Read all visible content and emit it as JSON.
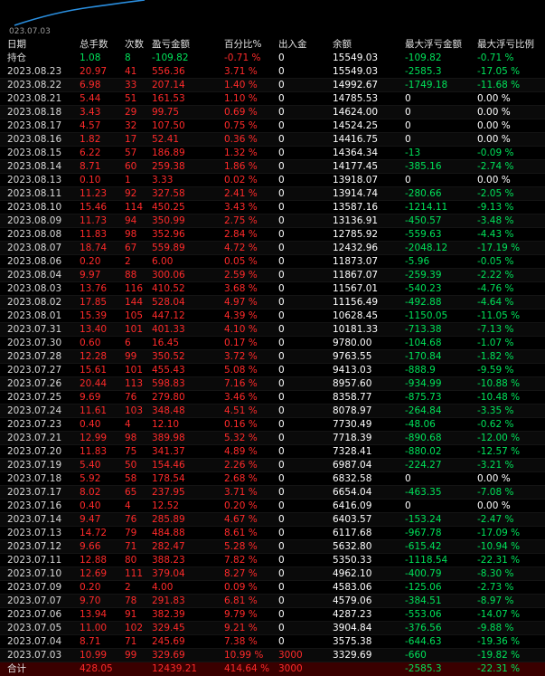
{
  "chart": {
    "date_label": "023.07.03"
  },
  "headers": [
    "日期",
    "总手数",
    "次数",
    "盈亏金额",
    "百分比%",
    "出入金",
    "余额",
    "最大浮亏金额",
    "最大浮亏比例"
  ],
  "position_row": {
    "date": "持仓",
    "lots": "1.08",
    "count": "8",
    "pnl": "-109.82",
    "pct": "-0.71 %",
    "flow": "0",
    "balance": "15549.03",
    "maxloss": "-109.82",
    "maxloss_pct": "-0.71 %"
  },
  "rows": [
    {
      "date": "2023.08.23",
      "lots": "20.97",
      "count": "41",
      "pnl": "556.36",
      "pct": "3.71 %",
      "flow": "0",
      "balance": "15549.03",
      "maxloss": "-2585.3",
      "maxloss_pct": "-17.05 %"
    },
    {
      "date": "2023.08.22",
      "lots": "6.98",
      "count": "33",
      "pnl": "207.14",
      "pct": "1.40 %",
      "flow": "0",
      "balance": "14992.67",
      "maxloss": "-1749.18",
      "maxloss_pct": "-11.68 %"
    },
    {
      "date": "2023.08.21",
      "lots": "5.44",
      "count": "51",
      "pnl": "161.53",
      "pct": "1.10 %",
      "flow": "0",
      "balance": "14785.53",
      "maxloss": "0",
      "maxloss_pct": "0.00 %"
    },
    {
      "date": "2023.08.18",
      "lots": "3.43",
      "count": "29",
      "pnl": "99.75",
      "pct": "0.69 %",
      "flow": "0",
      "balance": "14624.00",
      "maxloss": "0",
      "maxloss_pct": "0.00 %"
    },
    {
      "date": "2023.08.17",
      "lots": "4.57",
      "count": "32",
      "pnl": "107.50",
      "pct": "0.75 %",
      "flow": "0",
      "balance": "14524.25",
      "maxloss": "0",
      "maxloss_pct": "0.00 %"
    },
    {
      "date": "2023.08.16",
      "lots": "1.82",
      "count": "17",
      "pnl": "52.41",
      "pct": "0.36 %",
      "flow": "0",
      "balance": "14416.75",
      "maxloss": "0",
      "maxloss_pct": "0.00 %"
    },
    {
      "date": "2023.08.15",
      "lots": "6.22",
      "count": "57",
      "pnl": "186.89",
      "pct": "1.32 %",
      "flow": "0",
      "balance": "14364.34",
      "maxloss": "-13",
      "maxloss_pct": "-0.09 %"
    },
    {
      "date": "2023.08.14",
      "lots": "8.71",
      "count": "60",
      "pnl": "259.38",
      "pct": "1.86 %",
      "flow": "0",
      "balance": "14177.45",
      "maxloss": "-385.16",
      "maxloss_pct": "-2.74 %"
    },
    {
      "date": "2023.08.13",
      "lots": "0.10",
      "count": "1",
      "pnl": "3.33",
      "pct": "0.02 %",
      "flow": "0",
      "balance": "13918.07",
      "maxloss": "0",
      "maxloss_pct": "0.00 %"
    },
    {
      "date": "2023.08.11",
      "lots": "11.23",
      "count": "92",
      "pnl": "327.58",
      "pct": "2.41 %",
      "flow": "0",
      "balance": "13914.74",
      "maxloss": "-280.66",
      "maxloss_pct": "-2.05 %"
    },
    {
      "date": "2023.08.10",
      "lots": "15.46",
      "count": "114",
      "pnl": "450.25",
      "pct": "3.43 %",
      "flow": "0",
      "balance": "13587.16",
      "maxloss": "-1214.11",
      "maxloss_pct": "-9.13 %"
    },
    {
      "date": "2023.08.09",
      "lots": "11.73",
      "count": "94",
      "pnl": "350.99",
      "pct": "2.75 %",
      "flow": "0",
      "balance": "13136.91",
      "maxloss": "-450.57",
      "maxloss_pct": "-3.48 %"
    },
    {
      "date": "2023.08.08",
      "lots": "11.83",
      "count": "98",
      "pnl": "352.96",
      "pct": "2.84 %",
      "flow": "0",
      "balance": "12785.92",
      "maxloss": "-559.63",
      "maxloss_pct": "-4.43 %"
    },
    {
      "date": "2023.08.07",
      "lots": "18.74",
      "count": "67",
      "pnl": "559.89",
      "pct": "4.72 %",
      "flow": "0",
      "balance": "12432.96",
      "maxloss": "-2048.12",
      "maxloss_pct": "-17.19 %"
    },
    {
      "date": "2023.08.06",
      "lots": "0.20",
      "count": "2",
      "pnl": "6.00",
      "pct": "0.05 %",
      "flow": "0",
      "balance": "11873.07",
      "maxloss": "-5.96",
      "maxloss_pct": "-0.05 %"
    },
    {
      "date": "2023.08.04",
      "lots": "9.97",
      "count": "88",
      "pnl": "300.06",
      "pct": "2.59 %",
      "flow": "0",
      "balance": "11867.07",
      "maxloss": "-259.39",
      "maxloss_pct": "-2.22 %"
    },
    {
      "date": "2023.08.03",
      "lots": "13.76",
      "count": "116",
      "pnl": "410.52",
      "pct": "3.68 %",
      "flow": "0",
      "balance": "11567.01",
      "maxloss": "-540.23",
      "maxloss_pct": "-4.76 %"
    },
    {
      "date": "2023.08.02",
      "lots": "17.85",
      "count": "144",
      "pnl": "528.04",
      "pct": "4.97 %",
      "flow": "0",
      "balance": "11156.49",
      "maxloss": "-492.88",
      "maxloss_pct": "-4.64 %"
    },
    {
      "date": "2023.08.01",
      "lots": "15.39",
      "count": "105",
      "pnl": "447.12",
      "pct": "4.39 %",
      "flow": "0",
      "balance": "10628.45",
      "maxloss": "-1150.05",
      "maxloss_pct": "-11.05 %"
    },
    {
      "date": "2023.07.31",
      "lots": "13.40",
      "count": "101",
      "pnl": "401.33",
      "pct": "4.10 %",
      "flow": "0",
      "balance": "10181.33",
      "maxloss": "-713.38",
      "maxloss_pct": "-7.13 %"
    },
    {
      "date": "2023.07.30",
      "lots": "0.60",
      "count": "6",
      "pnl": "16.45",
      "pct": "0.17 %",
      "flow": "0",
      "balance": "9780.00",
      "maxloss": "-104.68",
      "maxloss_pct": "-1.07 %"
    },
    {
      "date": "2023.07.28",
      "lots": "12.28",
      "count": "99",
      "pnl": "350.52",
      "pct": "3.72 %",
      "flow": "0",
      "balance": "9763.55",
      "maxloss": "-170.84",
      "maxloss_pct": "-1.82 %"
    },
    {
      "date": "2023.07.27",
      "lots": "15.61",
      "count": "101",
      "pnl": "455.43",
      "pct": "5.08 %",
      "flow": "0",
      "balance": "9413.03",
      "maxloss": "-888.9",
      "maxloss_pct": "-9.59 %"
    },
    {
      "date": "2023.07.26",
      "lots": "20.44",
      "count": "113",
      "pnl": "598.83",
      "pct": "7.16 %",
      "flow": "0",
      "balance": "8957.60",
      "maxloss": "-934.99",
      "maxloss_pct": "-10.88 %"
    },
    {
      "date": "2023.07.25",
      "lots": "9.69",
      "count": "76",
      "pnl": "279.80",
      "pct": "3.46 %",
      "flow": "0",
      "balance": "8358.77",
      "maxloss": "-875.73",
      "maxloss_pct": "-10.48 %"
    },
    {
      "date": "2023.07.24",
      "lots": "11.61",
      "count": "103",
      "pnl": "348.48",
      "pct": "4.51 %",
      "flow": "0",
      "balance": "8078.97",
      "maxloss": "-264.84",
      "maxloss_pct": "-3.35 %"
    },
    {
      "date": "2023.07.23",
      "lots": "0.40",
      "count": "4",
      "pnl": "12.10",
      "pct": "0.16 %",
      "flow": "0",
      "balance": "7730.49",
      "maxloss": "-48.06",
      "maxloss_pct": "-0.62 %"
    },
    {
      "date": "2023.07.21",
      "lots": "12.99",
      "count": "98",
      "pnl": "389.98",
      "pct": "5.32 %",
      "flow": "0",
      "balance": "7718.39",
      "maxloss": "-890.68",
      "maxloss_pct": "-12.00 %"
    },
    {
      "date": "2023.07.20",
      "lots": "11.83",
      "count": "75",
      "pnl": "341.37",
      "pct": "4.89 %",
      "flow": "0",
      "balance": "7328.41",
      "maxloss": "-880.02",
      "maxloss_pct": "-12.57 %"
    },
    {
      "date": "2023.07.19",
      "lots": "5.40",
      "count": "50",
      "pnl": "154.46",
      "pct": "2.26 %",
      "flow": "0",
      "balance": "6987.04",
      "maxloss": "-224.27",
      "maxloss_pct": "-3.21 %"
    },
    {
      "date": "2023.07.18",
      "lots": "5.92",
      "count": "58",
      "pnl": "178.54",
      "pct": "2.68 %",
      "flow": "0",
      "balance": "6832.58",
      "maxloss": "0",
      "maxloss_pct": "0.00 %"
    },
    {
      "date": "2023.07.17",
      "lots": "8.02",
      "count": "65",
      "pnl": "237.95",
      "pct": "3.71 %",
      "flow": "0",
      "balance": "6654.04",
      "maxloss": "-463.35",
      "maxloss_pct": "-7.08 %"
    },
    {
      "date": "2023.07.16",
      "lots": "0.40",
      "count": "4",
      "pnl": "12.52",
      "pct": "0.20 %",
      "flow": "0",
      "balance": "6416.09",
      "maxloss": "0",
      "maxloss_pct": "0.00 %"
    },
    {
      "date": "2023.07.14",
      "lots": "9.47",
      "count": "76",
      "pnl": "285.89",
      "pct": "4.67 %",
      "flow": "0",
      "balance": "6403.57",
      "maxloss": "-153.24",
      "maxloss_pct": "-2.47 %"
    },
    {
      "date": "2023.07.13",
      "lots": "14.72",
      "count": "79",
      "pnl": "484.88",
      "pct": "8.61 %",
      "flow": "0",
      "balance": "6117.68",
      "maxloss": "-967.78",
      "maxloss_pct": "-17.09 %"
    },
    {
      "date": "2023.07.12",
      "lots": "9.66",
      "count": "71",
      "pnl": "282.47",
      "pct": "5.28 %",
      "flow": "0",
      "balance": "5632.80",
      "maxloss": "-615.42",
      "maxloss_pct": "-10.94 %"
    },
    {
      "date": "2023.07.11",
      "lots": "12.88",
      "count": "80",
      "pnl": "388.23",
      "pct": "7.82 %",
      "flow": "0",
      "balance": "5350.33",
      "maxloss": "-1118.54",
      "maxloss_pct": "-22.31 %"
    },
    {
      "date": "2023.07.10",
      "lots": "12.69",
      "count": "111",
      "pnl": "379.04",
      "pct": "8.27 %",
      "flow": "0",
      "balance": "4962.10",
      "maxloss": "-400.79",
      "maxloss_pct": "-8.30 %"
    },
    {
      "date": "2023.07.09",
      "lots": "0.20",
      "count": "2",
      "pnl": "4.00",
      "pct": "0.09 %",
      "flow": "0",
      "balance": "4583.06",
      "maxloss": "-125.06",
      "maxloss_pct": "-2.73 %"
    },
    {
      "date": "2023.07.07",
      "lots": "9.70",
      "count": "78",
      "pnl": "291.83",
      "pct": "6.81 %",
      "flow": "0",
      "balance": "4579.06",
      "maxloss": "-384.51",
      "maxloss_pct": "-8.97 %"
    },
    {
      "date": "2023.07.06",
      "lots": "13.94",
      "count": "91",
      "pnl": "382.39",
      "pct": "9.79 %",
      "flow": "0",
      "balance": "4287.23",
      "maxloss": "-553.06",
      "maxloss_pct": "-14.07 %"
    },
    {
      "date": "2023.07.05",
      "lots": "11.00",
      "count": "102",
      "pnl": "329.45",
      "pct": "9.21 %",
      "flow": "0",
      "balance": "3904.84",
      "maxloss": "-376.56",
      "maxloss_pct": "-9.88 %"
    },
    {
      "date": "2023.07.04",
      "lots": "8.71",
      "count": "71",
      "pnl": "245.69",
      "pct": "7.38 %",
      "flow": "0",
      "balance": "3575.38",
      "maxloss": "-644.63",
      "maxloss_pct": "-19.36 %"
    },
    {
      "date": "2023.07.03",
      "lots": "10.99",
      "count": "99",
      "pnl": "329.69",
      "pct": "10.99 %",
      "flow": "3000",
      "balance": "3329.69",
      "maxloss": "-660",
      "maxloss_pct": "-19.82 %"
    }
  ],
  "total_row": {
    "date": "合计",
    "lots": "428.05",
    "count": "",
    "pnl": "12439.21",
    "pct": "414.64 %",
    "flow": "3000",
    "balance": "",
    "maxloss": "-2585.3",
    "maxloss_pct": "-22.31 %"
  },
  "colors": {
    "red": "#ff2a2a",
    "green": "#00e35a",
    "line": "#2a8fe0",
    "total_bg": "#3a0000"
  }
}
